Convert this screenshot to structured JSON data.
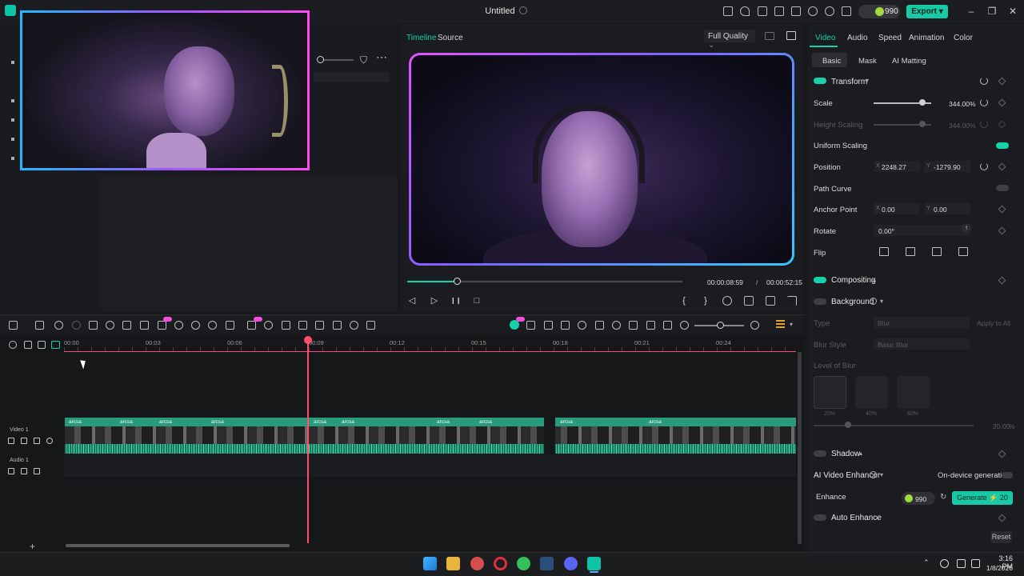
{
  "titlebar": {
    "document_title": "Untitled",
    "credits": "990",
    "export_label": "Export",
    "window_controls": [
      "minimize-icon",
      "restore-icon",
      "close-icon"
    ]
  },
  "player": {
    "tab_timeline": "Timeline",
    "tab_source": "Source",
    "quality": "Full Quality",
    "current_time": "00:00:08:59",
    "separator": "/",
    "total_time": "00:00:52:15",
    "progress_fraction": 0.18,
    "controls": {
      "prev": "◁",
      "play": "▷",
      "pause": "❙❙",
      "stop": "□",
      "mark_in": "{",
      "mark_out": "}"
    }
  },
  "properties": {
    "tabs": {
      "video": "Video",
      "audio": "Audio",
      "speed": "Speed",
      "animation": "Animation",
      "color": "Color"
    },
    "subtabs": {
      "basic": "Basic",
      "mask": "Mask",
      "ai_matting": "AI Matting"
    },
    "transform": {
      "title": "Transform",
      "scale_label": "Scale",
      "scale_value": "344.00",
      "scale_unit": "%",
      "height_scaling_label": "Height Scaling",
      "height_scaling_value": "344.00",
      "height_scaling_unit": "%",
      "uniform_scaling_label": "Uniform Scaling",
      "position_label": "Position",
      "position_x_label": "X",
      "position_x": "2248.27",
      "position_y_label": "Y",
      "position_y": "-1279.90",
      "path_curve_label": "Path Curve",
      "anchor_point_label": "Anchor Point",
      "anchor_x_label": "X",
      "anchor_x": "0.00",
      "anchor_y_label": "Y",
      "anchor_y": "0.00",
      "rotate_label": "Rotate",
      "rotate_value": "0.00°",
      "flip_label": "Flip"
    },
    "compositing": {
      "title": "Compositing"
    },
    "background": {
      "title": "Background",
      "type_label": "Type",
      "type_value": "Blur",
      "apply_all": "Apply to All",
      "blur_style_label": "Blur Style",
      "blur_style_value": "Basic Blur",
      "level_label": "Level of Blur",
      "presets": [
        "20%",
        "40%",
        "60%"
      ],
      "level_value": "20.00",
      "level_unit": "%"
    },
    "shadow": {
      "title": "Shadow"
    },
    "ai_enhancer": {
      "title": "AI Video Enhancer",
      "on_device": "On-device generation",
      "enhance_label": "Enhance",
      "credits": "990",
      "generate_label": "Generate",
      "generate_cost": "20"
    },
    "auto_enhance": {
      "title": "Auto Enhance"
    },
    "reset_label": "Reset"
  },
  "timeline": {
    "ruler_ticks": [
      "00:00",
      "00:03",
      "00:06",
      "00:09",
      "00:12",
      "00:15",
      "00:18",
      "00:21",
      "00:24"
    ],
    "track_video": "Video 1",
    "track_audio": "Audio 1",
    "clip_label": "arcsa",
    "add_track": "+"
  },
  "taskbar": {
    "time": "3:16 PM",
    "date": "1/8/2026",
    "tray_icon": "chevron-up-icon"
  },
  "colors": {
    "accent": "#17c9a5",
    "playhead": "#ff4d6d"
  }
}
